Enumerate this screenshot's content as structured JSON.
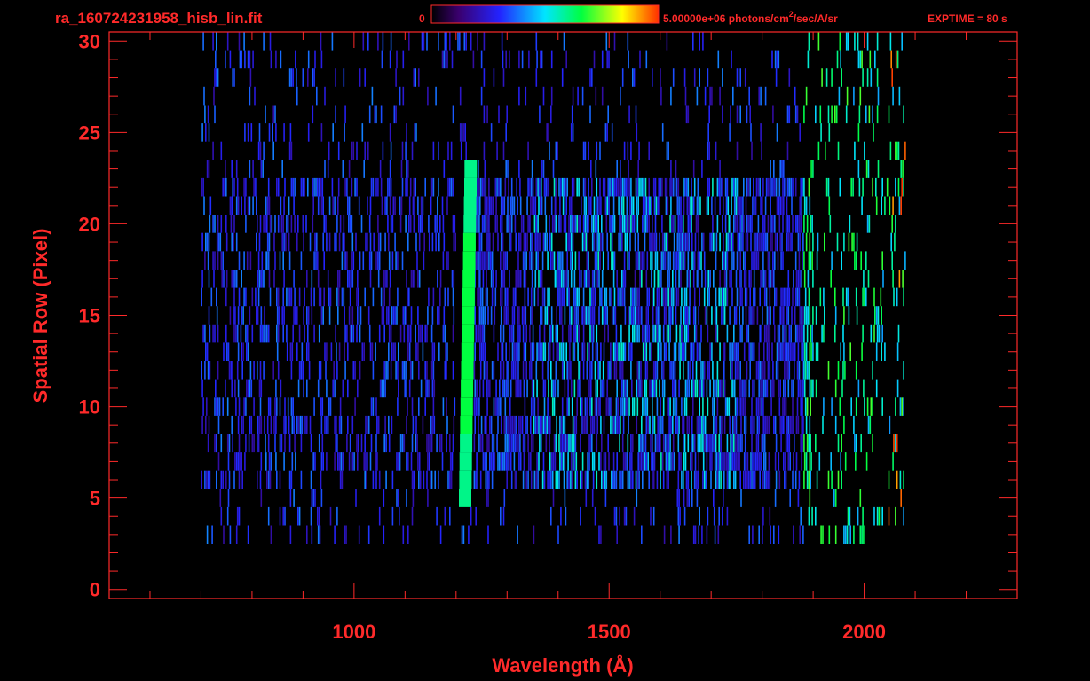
{
  "header": {
    "filename": "ra_160724231958_hisb_lin.fit",
    "colorbar_min_label": "0",
    "colorbar_max_label": "5.00000e+06 photons/cm",
    "colorbar_units_exponent": "2",
    "colorbar_units_suffix": "/sec/A/sr",
    "exptime": "EXPTIME = 80 s"
  },
  "colors": {
    "text_and_axes": "#ff2a2a",
    "background": "#000000",
    "colormap": [
      "#000000",
      "#3a006e",
      "#2323ff",
      "#00e5ff",
      "#00ff40",
      "#ffff00",
      "#ff3000"
    ]
  },
  "chart_data": {
    "type": "heatmap",
    "xlabel": "Wavelength (Å)",
    "ylabel": "Spatial Row (Pixel)",
    "xlim": [
      520,
      2300
    ],
    "ylim": [
      -0.5,
      30.5
    ],
    "xticks": [
      1000,
      1500,
      2000
    ],
    "yticks": [
      0,
      5,
      10,
      15,
      20,
      25,
      30
    ],
    "colorbar_range": [
      0,
      5000000
    ],
    "grid": false,
    "rows_range": [
      3,
      30
    ],
    "wavelength_range": [
      700,
      2080
    ],
    "lyman_alpha_line": {
      "wavelength": 1216,
      "rows": [
        5,
        23
      ]
    },
    "bright_region": {
      "wavelength": [
        1200,
        1900
      ],
      "rows": [
        6,
        22
      ]
    }
  }
}
